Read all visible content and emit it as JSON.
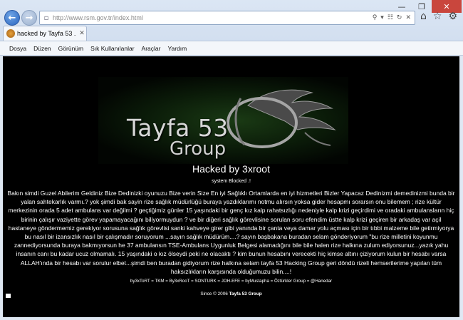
{
  "browser": {
    "url": "http://www.rsm.gov.tr/index.html",
    "tab_title": "hacked by Tayfa 53 ...",
    "menu": [
      "Dosya",
      "Düzen",
      "Görünüm",
      "Sık Kullanılanlar",
      "Araçlar",
      "Yardım"
    ]
  },
  "page": {
    "logo": {
      "line1": "Tayfa 53",
      "line2": "Group"
    },
    "heading": "Hacked by 3xroot",
    "subheading": "system Blocked .!",
    "message": "Bakın simdi Guzel Abilerim Geldiniz Bize Dedinizki oyunuzu Bize verin Size En iyi Sağlıklı Ortamlarda en iyi hizmetleri Bizler Yapacaz Dedinizmi demedinizmi bunda bir yalan sahtekarlık varmı.? yok şimdi bak sayin rize sağlık müdürlüğü buraya yazdıklarımı notmu alırsın yoksa gider hesapmı sorarsın onu bilemem ; rize kültür merkezinin orada 5 adet ambulans var değilmi ? geçtiğimiz günler 15 yaşındaki bir genç kız kalp rahatsızlığı nedeniyle kalp krizi geçirdimi ve oradaki ambulansların hiç birinin çalışır vaziyette görev yapamayacağını biliyormuydun ? ve bir diğeri sağlık görevlisine sorulan soru efendim üstte kalp krizi geçiren bir arkadaş var açil hastaneye göndermemiz gerekiyor sorusuna sağlık görevlisi sanki kahveye girer gibi yanında bir çanta veya damar yolu açması için bir tıbbi malzeme bile getirmiyorya bu nasıl bir izansızlık nasıl bir çalışmadır soruyorum ...sayın sağlık müdürüm....? sayın başbakana buradan selam gönderiyorum \"bu rize milletini koyunmu zannediyorsunda buraya bakmıyorsun he 37 ambulansın TSE-Ambulans Uygunluk Belgesi alamadığını bile bile halen rize halkına zulum ediyorsunuz...yazık yahu insanın canı bu kadar ucuz olmamalı. 15 yaşındaki o kız ölseydi peki ne olacaktı ? kim bunun hesabını verecekti hiç kimse altını çiziyorum kulun bir hesabı varsa ALLAH'ında bir hesabı var sorulur elbet...şimdi ben buradan gidiyorum rize halkına selam tayfa 53 Hacking Group geri döndü rizeli hemserilerime yapılan tüm haksızlıkların karşısında olduğumuzu bilin....!",
    "credits": "by3xToRT = TKM = By3xRooT = SONTURK = JOH-EFE = byMustapha = Öztürkler Group = @Hanedar",
    "since_prefix": "Since © 2006",
    "since_brand": "Tayfa 53 Group"
  }
}
